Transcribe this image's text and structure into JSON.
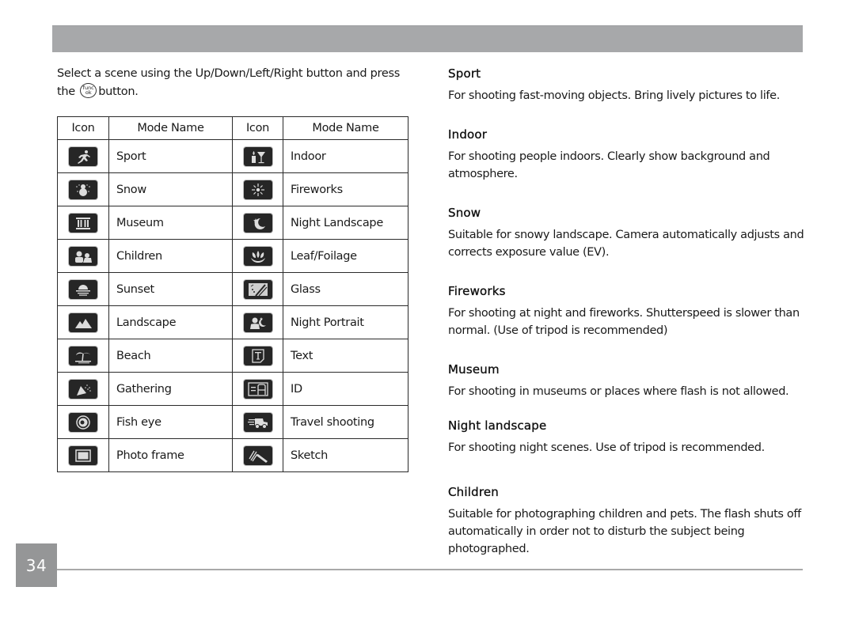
{
  "page": {
    "number": "34"
  },
  "intro": {
    "line1": "Select a scene using the Up/Down/Left/Right button and press",
    "line2_prefix": "the",
    "line2_suffix": "button.",
    "func_button": {
      "top": "func",
      "bottom": "ok",
      "icon": "func-ok-button-icon"
    }
  },
  "table": {
    "headers": [
      "Icon",
      "Mode Name",
      "Icon",
      "Mode Name"
    ],
    "rows": [
      {
        "left": {
          "icon": "sport-icon",
          "name": "Sport"
        },
        "right": {
          "icon": "indoor-icon",
          "name": "Indoor"
        }
      },
      {
        "left": {
          "icon": "snow-icon",
          "name": "Snow"
        },
        "right": {
          "icon": "fireworks-icon",
          "name": "Fireworks"
        }
      },
      {
        "left": {
          "icon": "museum-icon",
          "name": "Museum"
        },
        "right": {
          "icon": "night-landscape-icon",
          "name": "Night Landscape"
        }
      },
      {
        "left": {
          "icon": "children-icon",
          "name": "Children"
        },
        "right": {
          "icon": "leaf-foilage-icon",
          "name": "Leaf/Foilage"
        }
      },
      {
        "left": {
          "icon": "sunset-icon",
          "name": "Sunset"
        },
        "right": {
          "icon": "glass-icon",
          "name": "Glass"
        }
      },
      {
        "left": {
          "icon": "landscape-icon",
          "name": "Landscape"
        },
        "right": {
          "icon": "night-portrait-icon",
          "name": "Night Portrait"
        }
      },
      {
        "left": {
          "icon": "beach-icon",
          "name": "Beach"
        },
        "right": {
          "icon": "text-icon",
          "name": "Text"
        }
      },
      {
        "left": {
          "icon": "gathering-icon",
          "name": "Gathering"
        },
        "right": {
          "icon": "id-icon",
          "name": "ID"
        }
      },
      {
        "left": {
          "icon": "fish-eye-icon",
          "name": "Fish eye"
        },
        "right": {
          "icon": "travel-shooting-icon",
          "name": "Travel shooting"
        }
      },
      {
        "left": {
          "icon": "photo-frame-icon",
          "name": "Photo frame"
        },
        "right": {
          "icon": "sketch-icon",
          "name": "Sketch"
        }
      }
    ]
  },
  "descriptions": [
    {
      "title": "Sport",
      "body": "For shooting fast-moving objects. Bring lively pictures to life."
    },
    {
      "title": "Indoor",
      "body": "For shooting people indoors. Clearly show background and atmosphere."
    },
    {
      "title": "Snow",
      "body": "Suitable for snowy landscape. Camera automatically adjusts and corrects exposure value (EV)."
    },
    {
      "title": "Fireworks",
      "body": "For shooting at night and fireworks. Shutterspeed is slower than normal. (Use of tripod is recommended)"
    },
    {
      "title": "Museum",
      "body": "For shooting in museums or places where flash is not allowed."
    },
    {
      "title": "Night landscape",
      "body": "For shooting night scenes. Use of tripod is recommended."
    },
    {
      "title": "Children",
      "body": "Suitable for photographing children and pets. The flash shuts off automatically in order not to disturb the subject being photographed."
    }
  ],
  "colors": {
    "header_bar": "#a7a8aa",
    "page_number_bg": "#959697",
    "icon_bg": "#262626",
    "footer_line": "#a9a9a9"
  }
}
